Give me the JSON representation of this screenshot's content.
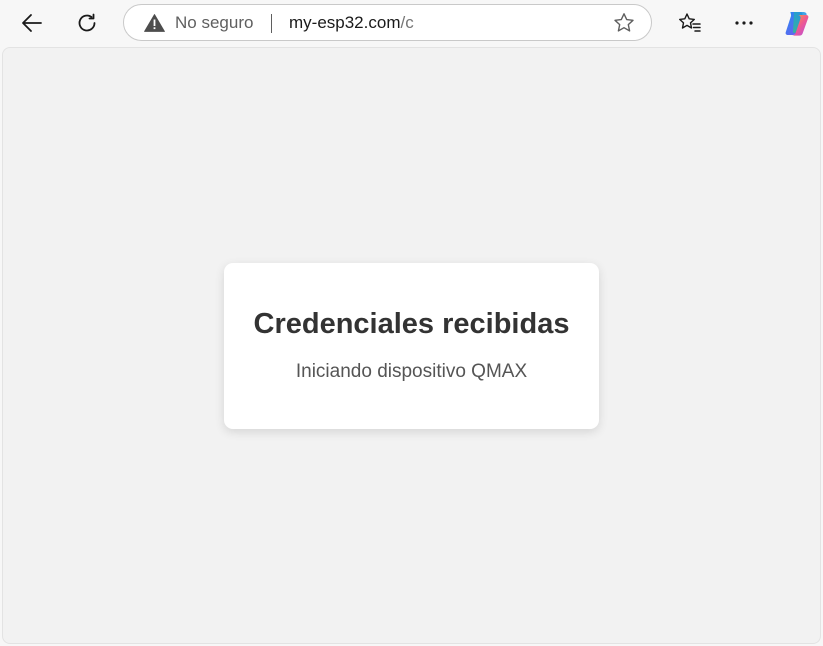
{
  "browser": {
    "security_label": "No seguro",
    "url_host": "my-esp32.com",
    "url_path": "/c",
    "icons": {
      "back": "back-arrow-icon",
      "reload": "reload-icon",
      "warning": "warning-triangle-icon",
      "favorite": "star-icon",
      "favorites": "favorites-list-icon",
      "menu": "more-options-icon",
      "copilot": "copilot-icon"
    }
  },
  "page": {
    "card_title": "Credenciales recibidas",
    "card_message": "Iniciando dispositivo QMAX"
  },
  "colors": {
    "page_background": "#f2f2f2",
    "card_background": "#ffffff",
    "title_text": "#333333",
    "message_text": "#555555"
  }
}
